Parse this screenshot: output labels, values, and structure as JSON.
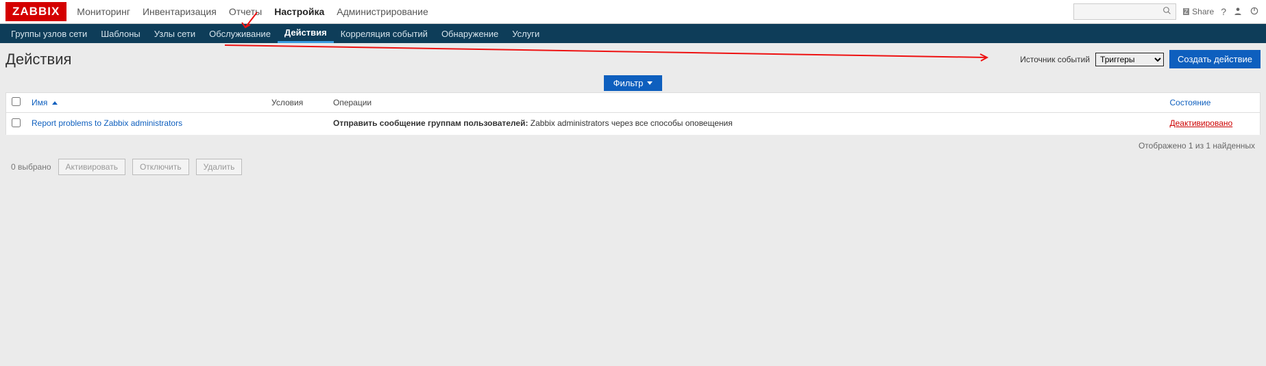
{
  "logo": "ZABBIX",
  "topnav": {
    "items": [
      {
        "label": "Мониторинг"
      },
      {
        "label": "Инвентаризация"
      },
      {
        "label": "Отчеты"
      },
      {
        "label": "Настройка"
      },
      {
        "label": "Администрирование"
      }
    ]
  },
  "share_label": "Share",
  "subnav": {
    "items": [
      {
        "label": "Группы узлов сети"
      },
      {
        "label": "Шаблоны"
      },
      {
        "label": "Узлы сети"
      },
      {
        "label": "Обслуживание"
      },
      {
        "label": "Действия"
      },
      {
        "label": "Корреляция событий"
      },
      {
        "label": "Обнаружение"
      },
      {
        "label": "Услуги"
      }
    ]
  },
  "page": {
    "title": "Действия",
    "source_label": "Источник событий",
    "source_value": "Триггеры",
    "create_button": "Создать действие",
    "filter_button": "Фильтр"
  },
  "table": {
    "headers": {
      "name": "Имя",
      "conditions": "Условия",
      "operations": "Операции",
      "state": "Состояние"
    },
    "rows": [
      {
        "name": "Report problems to Zabbix administrators",
        "conditions": "",
        "op_prefix": "Отправить сообщение группам пользователей:",
        "op_rest": " Zabbix administrators через все способы оповещения",
        "state": "Деактивировано"
      }
    ]
  },
  "summary": "Отображено 1 из 1 найденных",
  "bulk": {
    "selected": "0 выбрано",
    "activate": "Активировать",
    "deactivate": "Отключить",
    "delete": "Удалить"
  }
}
